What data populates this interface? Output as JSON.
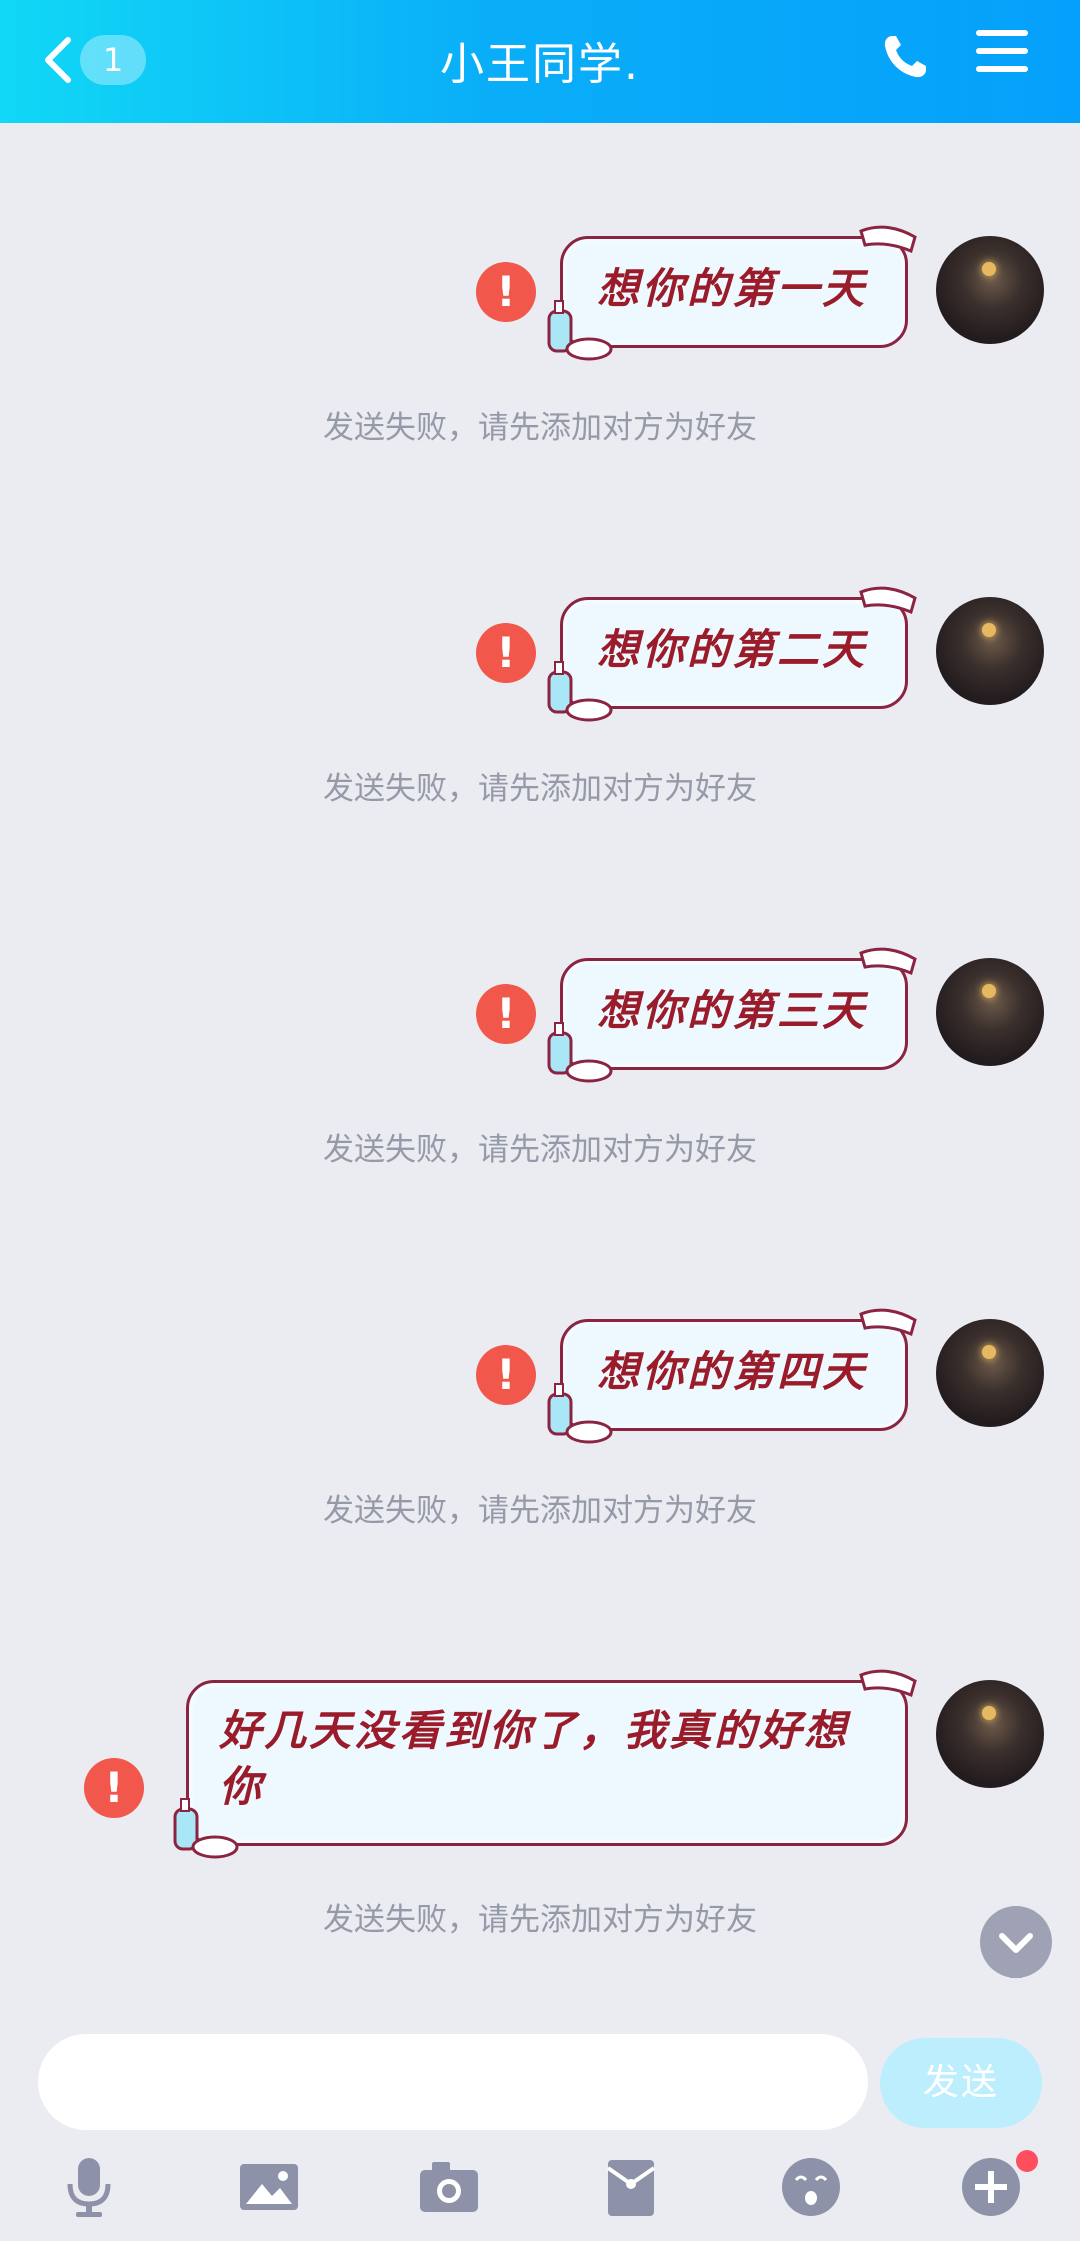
{
  "header": {
    "title": "小王同学.",
    "unread_count": "1",
    "back_icon": "chevron-left-icon",
    "call_icon": "phone-icon",
    "menu_icon": "hamburger-menu-icon",
    "gradient_colors": [
      "#11d8f6",
      "#05a0fb"
    ]
  },
  "messages": [
    {
      "text": "想你的第一天",
      "status": "发送失败，请先添加对方为好友"
    },
    {
      "text": "想你的第二天",
      "status": "发送失败，请先添加对方为好友"
    },
    {
      "text": "想你的第三天",
      "status": "发送失败，请先添加对方为好友"
    },
    {
      "text": "想你的第四天",
      "status": "发送失败，请先添加对方为好友"
    },
    {
      "text": "好几天没看到你了，我真的好想你",
      "status": "发送失败，请先添加对方为好友"
    }
  ],
  "composer": {
    "input_value": "",
    "send_label": "发送"
  },
  "toolbar": [
    "microphone-icon",
    "image-icon",
    "camera-icon",
    "red-packet-icon",
    "emoji-icon",
    "plus-icon"
  ],
  "colors": {
    "background": "#ebecf2",
    "error": "#f2574b",
    "bubble_text": "#9a1b2a",
    "send_button": "#bdeefd"
  }
}
